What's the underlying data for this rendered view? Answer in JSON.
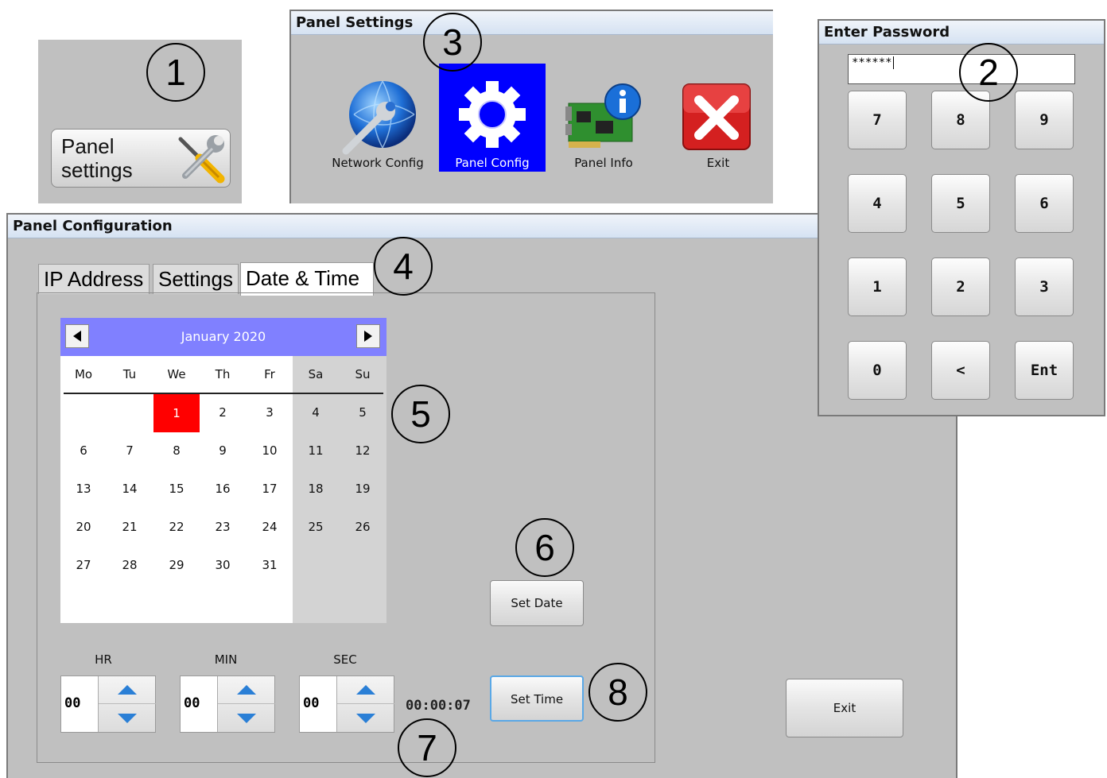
{
  "callouts": [
    "1",
    "2",
    "3",
    "4",
    "5",
    "6",
    "7",
    "8"
  ],
  "panel1": {
    "button_label_line1": "Panel",
    "button_label_line2": "settings",
    "icon": "tools-icon"
  },
  "panel_settings": {
    "title": "Panel Settings",
    "items": [
      {
        "label": "Network Config",
        "icon": "globe-wrench-icon"
      },
      {
        "label": "Panel Config",
        "icon": "gear-icon",
        "selected": true
      },
      {
        "label": "Panel Info",
        "icon": "circuit-board-info-icon"
      },
      {
        "label": "Exit",
        "icon": "close-icon"
      }
    ],
    "selected_color": "#0000ff"
  },
  "password": {
    "title": "Enter Password",
    "value": "******",
    "keys": [
      "7",
      "8",
      "9",
      "4",
      "5",
      "6",
      "1",
      "2",
      "3",
      "0",
      "<",
      "Ent"
    ]
  },
  "panel_config": {
    "title": "Panel Configuration",
    "tabs": [
      {
        "label": "IP Address"
      },
      {
        "label": "Settings"
      },
      {
        "label": "Date & Time",
        "active": true
      }
    ],
    "calendar": {
      "month_label": "January 2020",
      "weekdays": [
        "Mo",
        "Tu",
        "We",
        "Th",
        "Fr",
        "Sa",
        "Su"
      ],
      "days": [
        "1",
        "2",
        "3",
        "4",
        "5",
        "6",
        "7",
        "8",
        "9",
        "10",
        "11",
        "12",
        "13",
        "14",
        "15",
        "16",
        "17",
        "18",
        "19",
        "20",
        "21",
        "22",
        "23",
        "24",
        "25",
        "26",
        "27",
        "28",
        "29",
        "30",
        "31"
      ],
      "selected_day": "1",
      "header_color": "#8080ff",
      "selected_color": "#ff0000"
    },
    "set_date_label": "Set Date",
    "time": {
      "hr_label": "HR",
      "min_label": "MIN",
      "sec_label": "SEC",
      "hr": "00",
      "min": "00",
      "sec": "00",
      "clock": "00:00:07"
    },
    "set_time_label": "Set Time",
    "exit_label": "Exit"
  }
}
